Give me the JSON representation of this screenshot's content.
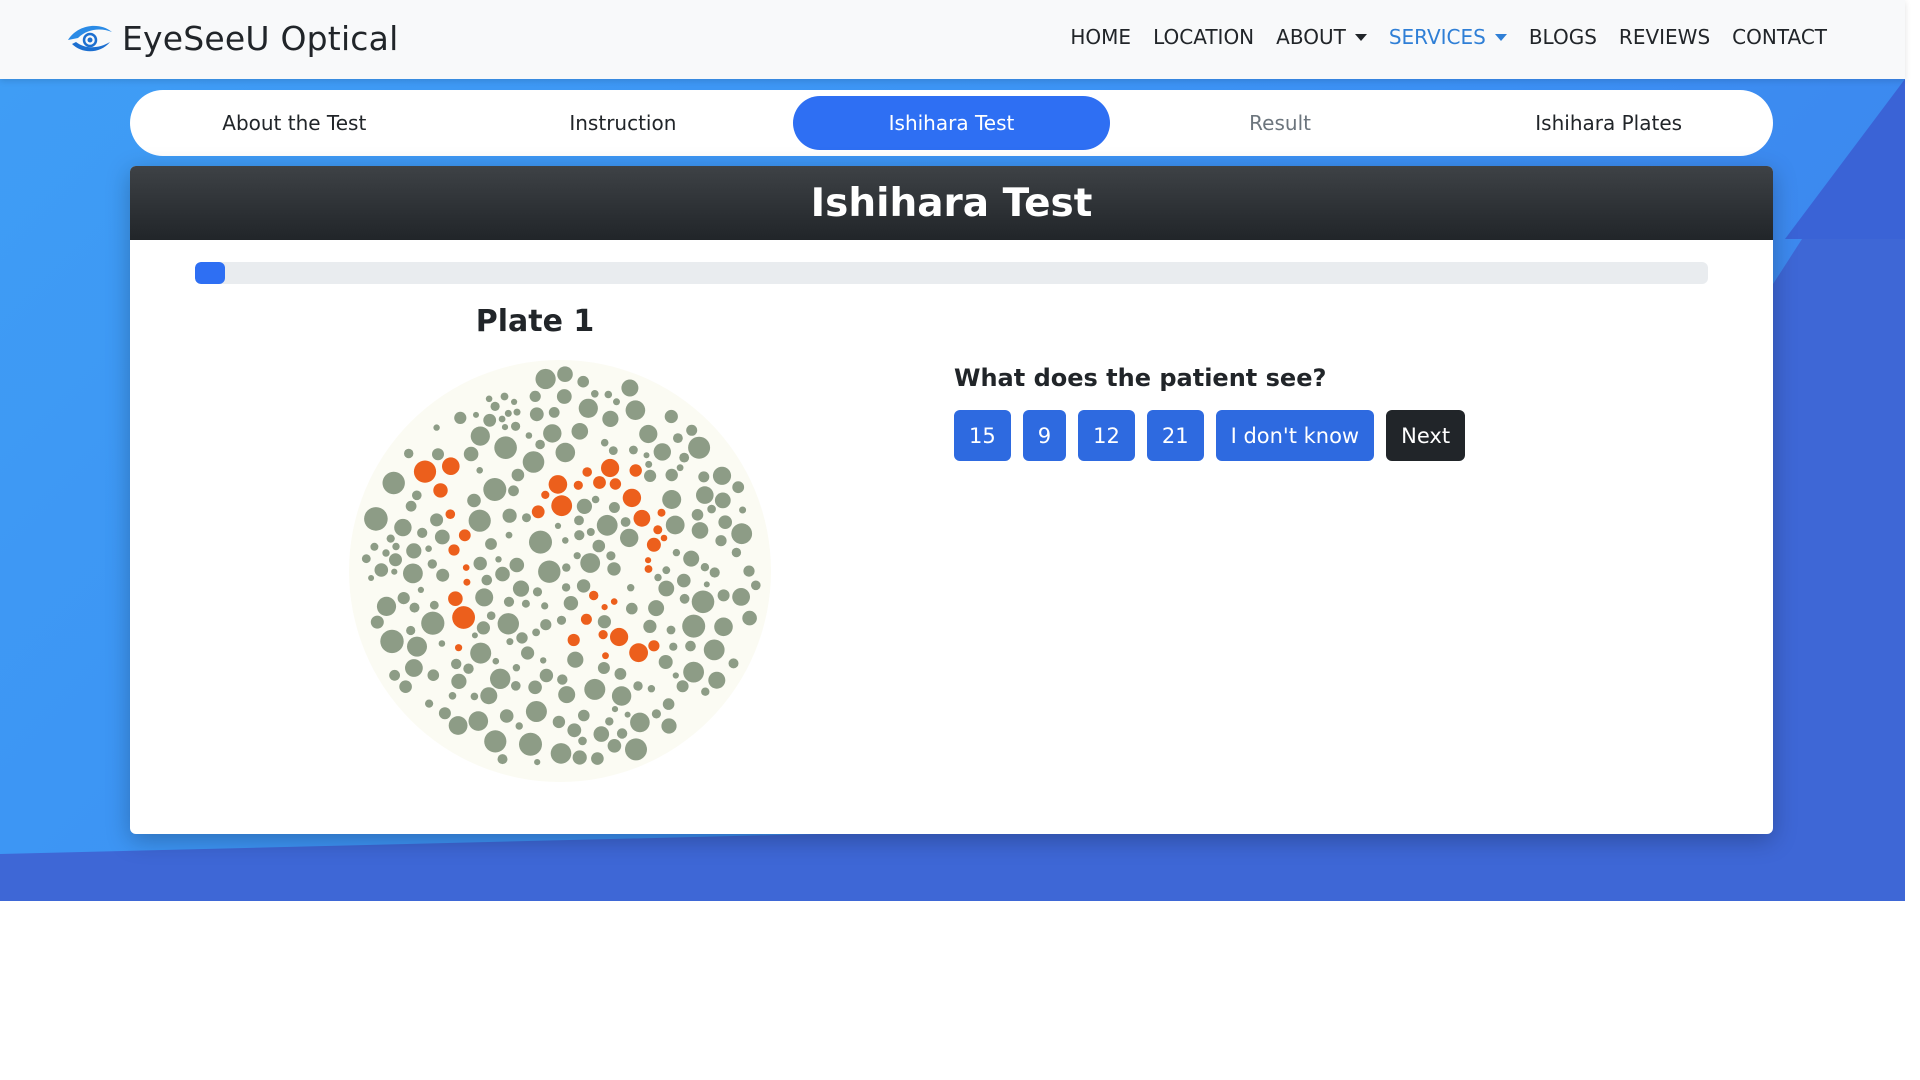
{
  "brand": {
    "name": "EyeSeeU Optical",
    "logo_icon": "eye-swoosh-icon"
  },
  "nav": {
    "items": [
      {
        "label": "HOME",
        "dropdown": false,
        "active": false
      },
      {
        "label": "LOCATION",
        "dropdown": false,
        "active": false
      },
      {
        "label": "ABOUT",
        "dropdown": true,
        "active": false
      },
      {
        "label": "SERVICES",
        "dropdown": true,
        "active": true
      },
      {
        "label": "BLOGS",
        "dropdown": false,
        "active": false
      },
      {
        "label": "REVIEWS",
        "dropdown": false,
        "active": false
      },
      {
        "label": "CONTACT",
        "dropdown": false,
        "active": false
      }
    ]
  },
  "tabs": [
    {
      "label": "About the Test",
      "state": "normal"
    },
    {
      "label": "Instruction",
      "state": "normal"
    },
    {
      "label": "Ishihara Test",
      "state": "active"
    },
    {
      "label": "Result",
      "state": "muted"
    },
    {
      "label": "Ishihara Plates",
      "state": "normal"
    }
  ],
  "card": {
    "title": "Ishihara Test",
    "progress_percent": 2,
    "plate_title": "Plate 1",
    "question": "What does the patient see?",
    "answers": [
      "15",
      "9",
      "12",
      "21",
      "I don't know"
    ],
    "next_label": "Next"
  },
  "colors": {
    "accent": "#2e6ff3",
    "nav_active": "#2f7fd6",
    "dark": "#212529",
    "hero_light": "#3f9df5",
    "hero_dark": "#3e67d6",
    "plate_dot_background": "#8d9c86",
    "plate_dot_figure": "#ec5f1c"
  }
}
